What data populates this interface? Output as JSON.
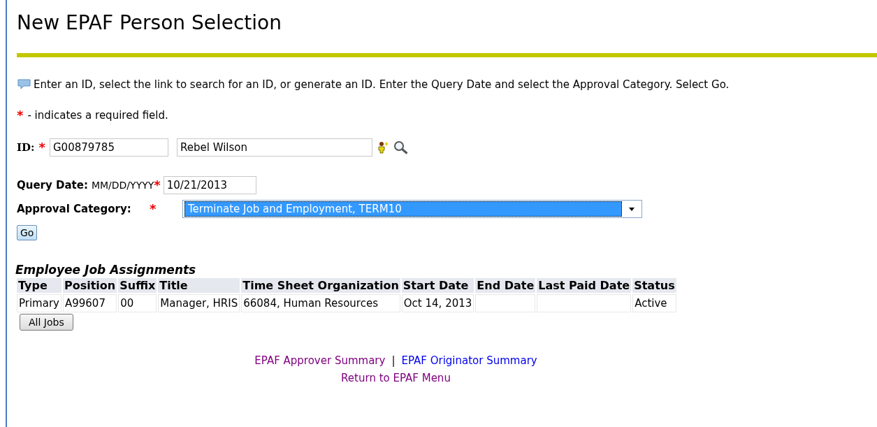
{
  "title": "New EPAF Person Selection",
  "info": "Enter an ID, select the link to search for an ID, or generate an ID. Enter the Query Date and select the Approval Category. Select Go.",
  "required_note": {
    "mark": "*",
    "text": "- indicates a required field."
  },
  "id_field": {
    "label": "ID:",
    "mark": "*",
    "value": "G00879785",
    "name_value": "Rebel Wilson"
  },
  "query_date": {
    "label": "Query Date:",
    "hint": "MM/DD/YYYY",
    "mark": "*",
    "value": "10/21/2013"
  },
  "approval_category": {
    "label": "Approval Category:",
    "mark": "*",
    "value": "Terminate Job and Employment, TERM10"
  },
  "go_button": "Go",
  "assignments": {
    "title": "Employee Job Assignments",
    "columns": [
      "Type",
      "Position",
      "Suffix",
      "Title",
      "Time Sheet Organization",
      "Start Date",
      "End Date",
      "Last Paid Date",
      "Status"
    ],
    "rows": [
      [
        "Primary",
        "A99607",
        "00",
        "Manager, HRIS",
        "66084, Human Resources",
        "Oct 14, 2013",
        "",
        "",
        "Active"
      ]
    ]
  },
  "all_jobs_button": "All Jobs",
  "links": [
    {
      "label": "EPAF Approver Summary",
      "visited": true
    },
    {
      "label": "EPAF Originator Summary",
      "visited": false
    }
  ],
  "separator": "|",
  "menu_link": {
    "label": "Return to EPAF Menu",
    "visited": true
  }
}
